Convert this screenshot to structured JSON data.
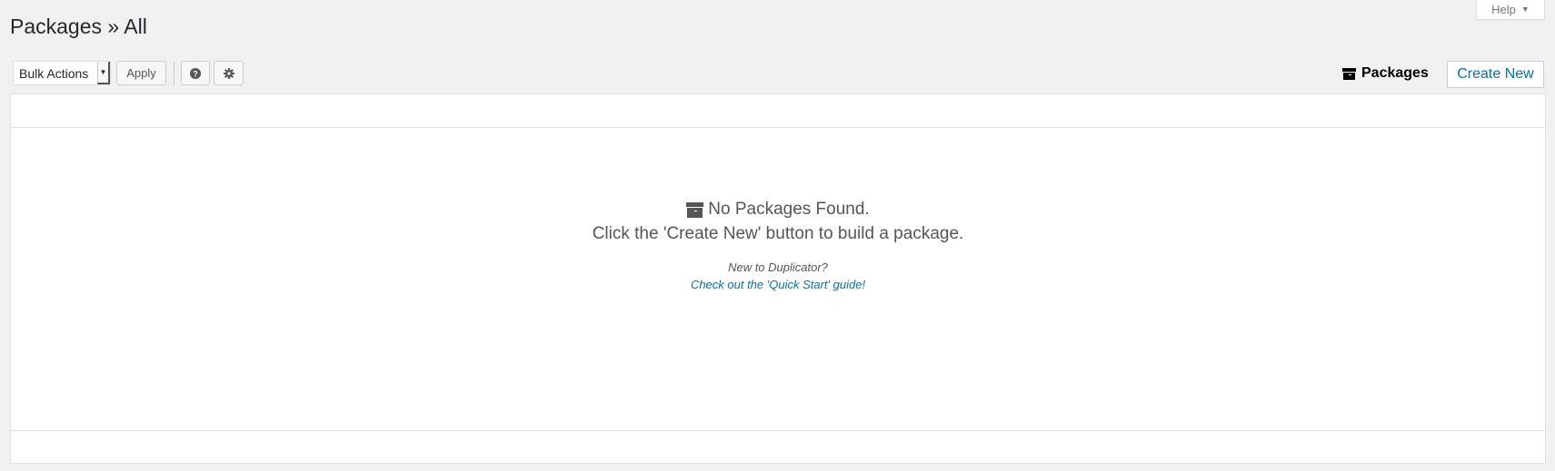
{
  "help": {
    "label": "Help",
    "arrow": "▼"
  },
  "page_title": "Packages » All",
  "toolbar": {
    "bulk_actions": "Bulk Actions",
    "apply": "Apply",
    "help_icon": "question-circle-icon",
    "settings_icon": "gear-icon"
  },
  "header_right": {
    "packages_label": "Packages",
    "create_new": "Create New"
  },
  "empty_state": {
    "title": "No Packages Found.",
    "subtitle": "Click the 'Create New' button to build a package.",
    "new_to": "New to Duplicator?",
    "guide_link": "Check out the 'Quick Start' guide!"
  },
  "colors": {
    "accent": "#0073aa",
    "background": "#f1f1f1"
  }
}
